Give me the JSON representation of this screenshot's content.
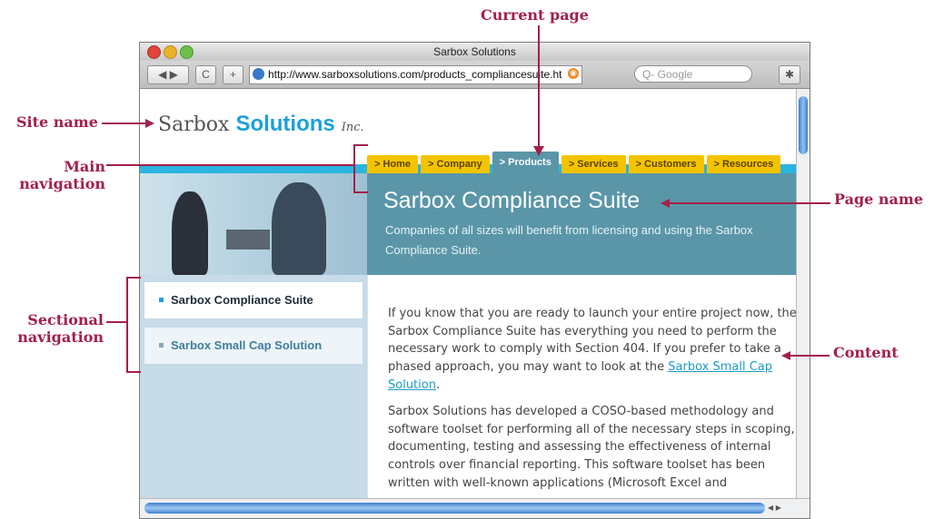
{
  "annotations": {
    "current_page": "Current page",
    "site_name": "Site name",
    "main_navigation": "Main navigation",
    "page_name": "Page name",
    "sectional_navigation": "Sectional navigation",
    "content": "Content"
  },
  "browser": {
    "window_title": "Sarbox Solutions",
    "back_forward": "◀ ▶",
    "reload_glyph": "C",
    "add_glyph": "+",
    "url": "http://www.sarboxsolutions.com/products_compliancesuite.ht",
    "search_placeholder": "Q- Google",
    "bug_glyph": "✱",
    "rss_glyph": "◉"
  },
  "site": {
    "logo_part1": "Sarbox ",
    "logo_part2": "Solutions",
    "logo_inc": "Inc.",
    "nav_tabs": [
      {
        "label": "> Home",
        "active": false
      },
      {
        "label": "> Company",
        "active": false
      },
      {
        "label": "> Products",
        "active": true
      },
      {
        "label": "> Services",
        "active": false
      },
      {
        "label": "> Customers",
        "active": false
      },
      {
        "label": "> Resources",
        "active": false
      }
    ],
    "page_name": "Sarbox Compliance Suite",
    "hero_subtitle": "Companies of all sizes will benefit from licensing and using the Sarbox Compliance Suite.",
    "section_nav": [
      {
        "label": "Sarbox Compliance Suite",
        "bullet_color": "#1ba1d8",
        "active": true
      },
      {
        "label": "Sarbox Small Cap Solution",
        "bullet_color": "#8aa9b8",
        "active": false
      }
    ],
    "content": {
      "para1_text": "If you know that you are ready to launch your entire project now, the Sarbox Compliance Suite has everything you need to perform the necessary work to comply with Section 404. If you prefer to take a phased approach, you may want to look at the ",
      "para1_link": "Sarbox Small Cap Solution",
      "para1_end": ".",
      "para2": "Sarbox Solutions has developed a COSO-based methodology and software toolset for performing all of the necessary steps in scoping, documenting, testing and assessing the effectiveness of internal controls over financial reporting. This software toolset has been written with well-known applications (Microsoft Excel and"
    }
  },
  "colors": {
    "annotation": "#a3204a",
    "tab_yellow": "#f5c400",
    "hero_teal": "#5a96a8",
    "accent_blue": "#1ba1d8"
  }
}
